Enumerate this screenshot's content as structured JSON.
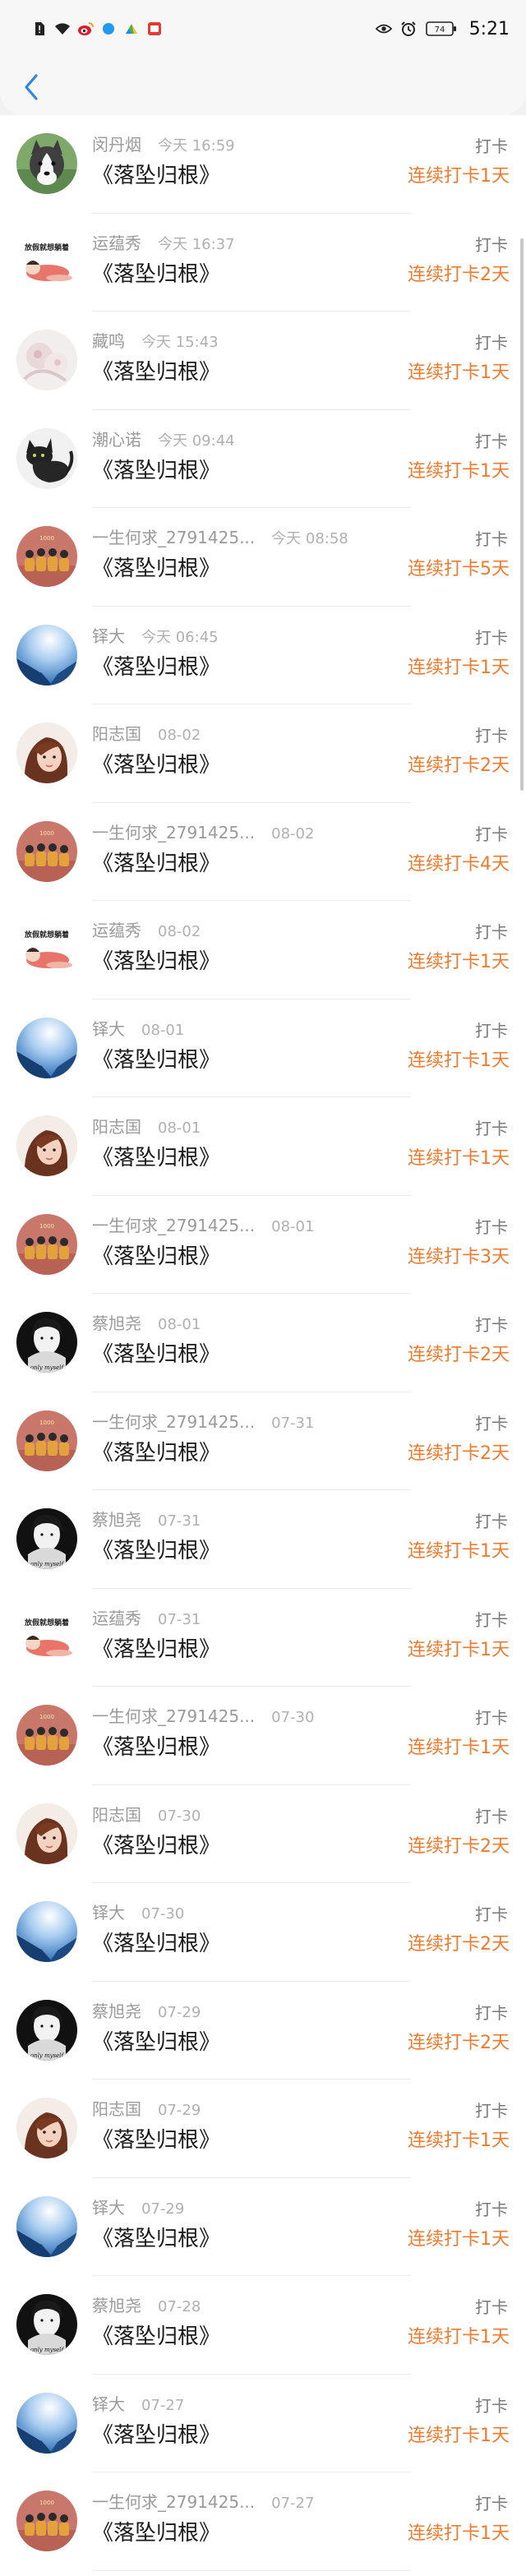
{
  "status_bar": {
    "time": "5:21",
    "battery_label": "74",
    "icons": [
      "sim-alert-icon",
      "wifi-icon",
      "weibo-icon",
      "app-dot-icon",
      "leaf-app-icon",
      "red-app-icon",
      "eye-icon",
      "alarm-icon",
      "battery-icon"
    ]
  },
  "nav": {
    "back_icon": "chevron-left-icon"
  },
  "colors": {
    "accent": "#ee7a2e",
    "back": "#2f86e0"
  },
  "records": [
    {
      "user": "闵丹烟",
      "time": "今天 16:59",
      "book": "《落坠归根》",
      "action": "打卡",
      "streak": "连续打卡1天",
      "avatar": "husky-avatar"
    },
    {
      "user": "运蕴秀",
      "time": "今天 16:37",
      "book": "《落坠归根》",
      "action": "打卡",
      "streak": "连续打卡2天",
      "avatar": "cartoon-sleep-avatar"
    },
    {
      "user": "藏鸣",
      "time": "今天 15:43",
      "book": "《落坠归根》",
      "action": "打卡",
      "streak": "连续打卡1天",
      "avatar": "floral-avatar"
    },
    {
      "user": "潮心诺",
      "time": "今天 09:44",
      "book": "《落坠归根》",
      "action": "打卡",
      "streak": "连续打卡1天",
      "avatar": "black-cat-avatar"
    },
    {
      "user": "一生何求_2791425...",
      "time": "今天 08:58",
      "book": "《落坠归根》",
      "action": "打卡",
      "streak": "连续打卡5天",
      "avatar": "group-photo-avatar"
    },
    {
      "user": "铎大",
      "time": "今天 06:45",
      "book": "《落坠归根》",
      "action": "打卡",
      "streak": "连续打卡1天",
      "avatar": "sky-building-avatar"
    },
    {
      "user": "阳志国",
      "time": "08-02",
      "book": "《落坠归根》",
      "action": "打卡",
      "streak": "连续打卡2天",
      "avatar": "girl-portrait-avatar"
    },
    {
      "user": "一生何求_2791425...",
      "time": "08-02",
      "book": "《落坠归根》",
      "action": "打卡",
      "streak": "连续打卡4天",
      "avatar": "group-photo-avatar"
    },
    {
      "user": "运蕴秀",
      "time": "08-02",
      "book": "《落坠归根》",
      "action": "打卡",
      "streak": "连续打卡1天",
      "avatar": "cartoon-sleep-avatar"
    },
    {
      "user": "铎大",
      "time": "08-01",
      "book": "《落坠归根》",
      "action": "打卡",
      "streak": "连续打卡1天",
      "avatar": "sky-building-avatar"
    },
    {
      "user": "阳志国",
      "time": "08-01",
      "book": "《落坠归根》",
      "action": "打卡",
      "streak": "连续打卡1天",
      "avatar": "girl-portrait-avatar"
    },
    {
      "user": "一生何求_2791425...",
      "time": "08-01",
      "book": "《落坠归根》",
      "action": "打卡",
      "streak": "连续打卡3天",
      "avatar": "group-photo-avatar"
    },
    {
      "user": "蔡旭尧",
      "time": "08-01",
      "book": "《落坠归根》",
      "action": "打卡",
      "streak": "连续打卡2天",
      "avatar": "bw-portrait-avatar"
    },
    {
      "user": "一生何求_2791425...",
      "time": "07-31",
      "book": "《落坠归根》",
      "action": "打卡",
      "streak": "连续打卡2天",
      "avatar": "group-photo-avatar"
    },
    {
      "user": "蔡旭尧",
      "time": "07-31",
      "book": "《落坠归根》",
      "action": "打卡",
      "streak": "连续打卡1天",
      "avatar": "bw-portrait-avatar"
    },
    {
      "user": "运蕴秀",
      "time": "07-31",
      "book": "《落坠归根》",
      "action": "打卡",
      "streak": "连续打卡1天",
      "avatar": "cartoon-sleep-avatar"
    },
    {
      "user": "一生何求_2791425...",
      "time": "07-30",
      "book": "《落坠归根》",
      "action": "打卡",
      "streak": "连续打卡1天",
      "avatar": "group-photo-avatar"
    },
    {
      "user": "阳志国",
      "time": "07-30",
      "book": "《落坠归根》",
      "action": "打卡",
      "streak": "连续打卡2天",
      "avatar": "girl-portrait-avatar"
    },
    {
      "user": "铎大",
      "time": "07-30",
      "book": "《落坠归根》",
      "action": "打卡",
      "streak": "连续打卡2天",
      "avatar": "sky-building-avatar"
    },
    {
      "user": "蔡旭尧",
      "time": "07-29",
      "book": "《落坠归根》",
      "action": "打卡",
      "streak": "连续打卡2天",
      "avatar": "bw-portrait-avatar"
    },
    {
      "user": "阳志国",
      "time": "07-29",
      "book": "《落坠归根》",
      "action": "打卡",
      "streak": "连续打卡1天",
      "avatar": "girl-portrait-avatar"
    },
    {
      "user": "铎大",
      "time": "07-29",
      "book": "《落坠归根》",
      "action": "打卡",
      "streak": "连续打卡1天",
      "avatar": "sky-building-avatar"
    },
    {
      "user": "蔡旭尧",
      "time": "07-28",
      "book": "《落坠归根》",
      "action": "打卡",
      "streak": "连续打卡1天",
      "avatar": "bw-portrait-avatar"
    },
    {
      "user": "铎大",
      "time": "07-27",
      "book": "《落坠归根》",
      "action": "打卡",
      "streak": "连续打卡1天",
      "avatar": "sky-building-avatar"
    },
    {
      "user": "一生何求_2791425...",
      "time": "07-27",
      "book": "《落坠归根》",
      "action": "打卡",
      "streak": "连续打卡1天",
      "avatar": "group-photo-avatar"
    }
  ]
}
